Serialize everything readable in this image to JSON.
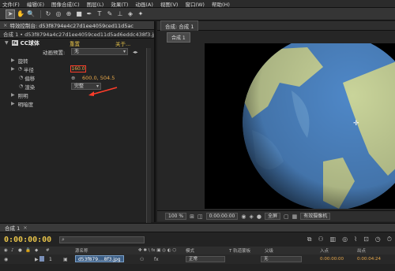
{
  "menu": [
    "文件(F)",
    "编辑(E)",
    "图像合成(C)",
    "图层(L)",
    "效果(T)",
    "动画(A)",
    "视图(V)",
    "窗口(W)",
    "帮助(H)"
  ],
  "toolbar": {
    "tools": [
      {
        "icon": "selection-arrow-icon",
        "glyph": "➤"
      },
      {
        "icon": "hand-icon",
        "glyph": "✋"
      },
      {
        "icon": "zoom-icon",
        "glyph": "🔍"
      },
      {
        "icon": "rotate-icon",
        "glyph": "↻"
      },
      {
        "icon": "camera-icon",
        "glyph": "◎"
      },
      {
        "icon": "pan-behind-icon",
        "glyph": "⊕"
      },
      {
        "icon": "rectangle-icon",
        "glyph": "■"
      },
      {
        "icon": "pen-icon",
        "glyph": "✒"
      },
      {
        "icon": "text-icon",
        "glyph": "T"
      },
      {
        "icon": "brush-icon",
        "glyph": "✎"
      },
      {
        "icon": "clone-icon",
        "glyph": "⊥"
      },
      {
        "icon": "eraser-icon",
        "glyph": "◈"
      },
      {
        "icon": "puppet-icon",
        "glyph": "✦"
      }
    ]
  },
  "effect_panel": {
    "tab_title": "特效控制台: d53f8794e4c27d1ee4059ced11d5ac",
    "subtitle": "合成 1 • d53f8794a4c27d1ee4059ced11d5ad6eddc438f3.jpg",
    "effect_name": "CC球体",
    "fx_badge": "fx",
    "reset_link": "重置",
    "about_link": "关于...",
    "anim_preset_label": "动画预置:",
    "anim_preset_value": "无",
    "props": {
      "rotation": "旋转",
      "radius": "半径",
      "radius_value": "160.0",
      "offset": "偏移",
      "offset_value": "600.0, 504.5",
      "render": "渲染",
      "render_value": "完整",
      "light": "照明",
      "shading": "明暗度"
    }
  },
  "comp_viewer": {
    "tab": "合成: 合成 1",
    "subtab": "合成 1",
    "zoom": "100 %",
    "timecode": "0:00:00:00",
    "resolution": "全屏",
    "camera": "有效摄像机"
  },
  "timeline": {
    "tab": "合成 1",
    "timecode": "0:00:00:00",
    "headers": {
      "source": "源名称",
      "mode": "模式",
      "trkmat": "T 轨道蒙板",
      "parent": "父级",
      "in": "入点",
      "out": "出点"
    },
    "layer": {
      "index": "1",
      "name": "d53f879....8f3.jpg",
      "mode": "正常",
      "parent": "无",
      "in_time": "0:00:00:00",
      "out_time": "0:00:04:24"
    }
  },
  "colors": {
    "accent_orange": "#e8a84a",
    "highlight_red": "#ff3d2a",
    "land": "#c9d49a",
    "ocean": "#4f88c8"
  }
}
